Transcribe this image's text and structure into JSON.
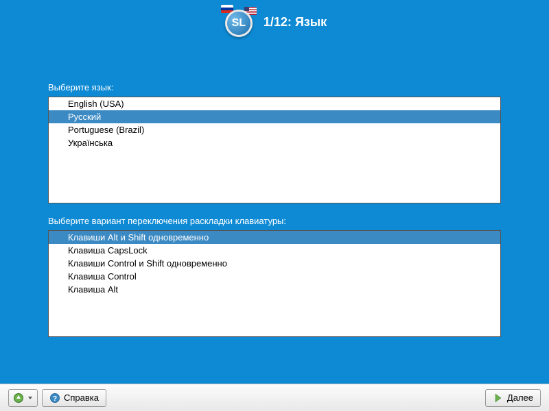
{
  "header": {
    "step_label": "1/12: Язык",
    "logo_text": "SL"
  },
  "language": {
    "label": "Выберите язык:",
    "items": [
      {
        "label": "English (USA)",
        "selected": false
      },
      {
        "label": "Русский",
        "selected": true
      },
      {
        "label": "Portuguese (Brazil)",
        "selected": false
      },
      {
        "label": "Українська",
        "selected": false
      }
    ]
  },
  "keyboard": {
    "label": "Выберите вариант переключения раскладки клавиатуры:",
    "items": [
      {
        "label": "Клавиши Alt и Shift одновременно",
        "selected": true
      },
      {
        "label": "Клавиша CapsLock",
        "selected": false
      },
      {
        "label": "Клавиши Control и Shift одновременно",
        "selected": false
      },
      {
        "label": "Клавиша Control",
        "selected": false
      },
      {
        "label": "Клавиша Alt",
        "selected": false
      }
    ]
  },
  "footer": {
    "help_label": "Справка",
    "next_label": "Далее"
  }
}
